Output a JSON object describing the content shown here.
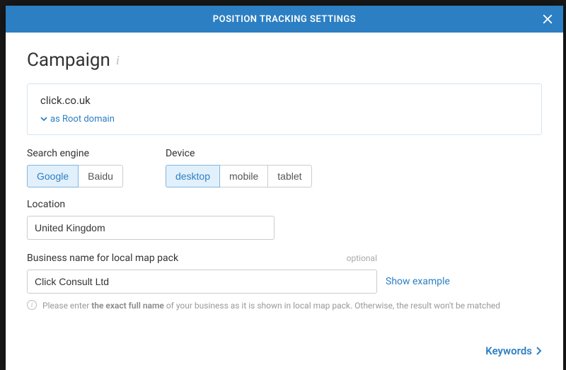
{
  "header": {
    "title": "POSITION TRACKING SETTINGS"
  },
  "page": {
    "title": "Campaign"
  },
  "campaign": {
    "domain": "click.co.uk",
    "domain_type_label": "as Root domain"
  },
  "search_engine": {
    "label": "Search engine",
    "options": [
      "Google",
      "Baidu"
    ],
    "selected": "Google"
  },
  "device": {
    "label": "Device",
    "options": [
      "desktop",
      "mobile",
      "tablet"
    ],
    "selected": "desktop"
  },
  "location": {
    "label": "Location",
    "value": "United Kingdom"
  },
  "business": {
    "label": "Business name for local map pack",
    "optional_tag": "optional",
    "value": "Click Consult Ltd",
    "show_example_label": "Show example",
    "hint_prefix": "Please enter ",
    "hint_strong": "the exact full name",
    "hint_suffix": " of your business as it is shown in local map pack. Otherwise, the result won't be matched"
  },
  "footer": {
    "next_label": "Keywords"
  }
}
